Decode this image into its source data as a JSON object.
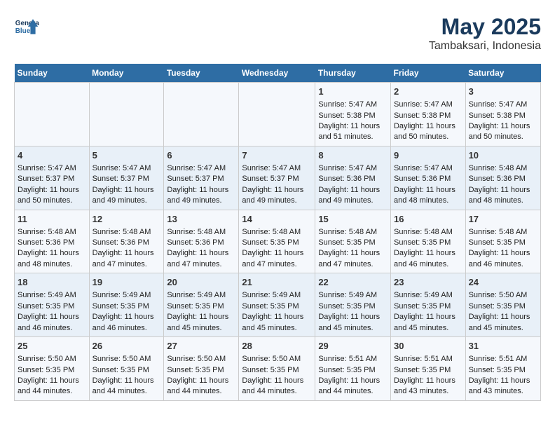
{
  "header": {
    "logo_line1": "General",
    "logo_line2": "Blue",
    "title": "May 2025",
    "subtitle": "Tambaksari, Indonesia"
  },
  "weekdays": [
    "Sunday",
    "Monday",
    "Tuesday",
    "Wednesday",
    "Thursday",
    "Friday",
    "Saturday"
  ],
  "weeks": [
    [
      {
        "day": "",
        "info": ""
      },
      {
        "day": "",
        "info": ""
      },
      {
        "day": "",
        "info": ""
      },
      {
        "day": "",
        "info": ""
      },
      {
        "day": "1",
        "info": "Sunrise: 5:47 AM\nSunset: 5:38 PM\nDaylight: 11 hours\nand 51 minutes."
      },
      {
        "day": "2",
        "info": "Sunrise: 5:47 AM\nSunset: 5:38 PM\nDaylight: 11 hours\nand 50 minutes."
      },
      {
        "day": "3",
        "info": "Sunrise: 5:47 AM\nSunset: 5:38 PM\nDaylight: 11 hours\nand 50 minutes."
      }
    ],
    [
      {
        "day": "4",
        "info": "Sunrise: 5:47 AM\nSunset: 5:37 PM\nDaylight: 11 hours\nand 50 minutes."
      },
      {
        "day": "5",
        "info": "Sunrise: 5:47 AM\nSunset: 5:37 PM\nDaylight: 11 hours\nand 49 minutes."
      },
      {
        "day": "6",
        "info": "Sunrise: 5:47 AM\nSunset: 5:37 PM\nDaylight: 11 hours\nand 49 minutes."
      },
      {
        "day": "7",
        "info": "Sunrise: 5:47 AM\nSunset: 5:37 PM\nDaylight: 11 hours\nand 49 minutes."
      },
      {
        "day": "8",
        "info": "Sunrise: 5:47 AM\nSunset: 5:36 PM\nDaylight: 11 hours\nand 49 minutes."
      },
      {
        "day": "9",
        "info": "Sunrise: 5:47 AM\nSunset: 5:36 PM\nDaylight: 11 hours\nand 48 minutes."
      },
      {
        "day": "10",
        "info": "Sunrise: 5:48 AM\nSunset: 5:36 PM\nDaylight: 11 hours\nand 48 minutes."
      }
    ],
    [
      {
        "day": "11",
        "info": "Sunrise: 5:48 AM\nSunset: 5:36 PM\nDaylight: 11 hours\nand 48 minutes."
      },
      {
        "day": "12",
        "info": "Sunrise: 5:48 AM\nSunset: 5:36 PM\nDaylight: 11 hours\nand 47 minutes."
      },
      {
        "day": "13",
        "info": "Sunrise: 5:48 AM\nSunset: 5:36 PM\nDaylight: 11 hours\nand 47 minutes."
      },
      {
        "day": "14",
        "info": "Sunrise: 5:48 AM\nSunset: 5:35 PM\nDaylight: 11 hours\nand 47 minutes."
      },
      {
        "day": "15",
        "info": "Sunrise: 5:48 AM\nSunset: 5:35 PM\nDaylight: 11 hours\nand 47 minutes."
      },
      {
        "day": "16",
        "info": "Sunrise: 5:48 AM\nSunset: 5:35 PM\nDaylight: 11 hours\nand 46 minutes."
      },
      {
        "day": "17",
        "info": "Sunrise: 5:48 AM\nSunset: 5:35 PM\nDaylight: 11 hours\nand 46 minutes."
      }
    ],
    [
      {
        "day": "18",
        "info": "Sunrise: 5:49 AM\nSunset: 5:35 PM\nDaylight: 11 hours\nand 46 minutes."
      },
      {
        "day": "19",
        "info": "Sunrise: 5:49 AM\nSunset: 5:35 PM\nDaylight: 11 hours\nand 46 minutes."
      },
      {
        "day": "20",
        "info": "Sunrise: 5:49 AM\nSunset: 5:35 PM\nDaylight: 11 hours\nand 45 minutes."
      },
      {
        "day": "21",
        "info": "Sunrise: 5:49 AM\nSunset: 5:35 PM\nDaylight: 11 hours\nand 45 minutes."
      },
      {
        "day": "22",
        "info": "Sunrise: 5:49 AM\nSunset: 5:35 PM\nDaylight: 11 hours\nand 45 minutes."
      },
      {
        "day": "23",
        "info": "Sunrise: 5:49 AM\nSunset: 5:35 PM\nDaylight: 11 hours\nand 45 minutes."
      },
      {
        "day": "24",
        "info": "Sunrise: 5:50 AM\nSunset: 5:35 PM\nDaylight: 11 hours\nand 45 minutes."
      }
    ],
    [
      {
        "day": "25",
        "info": "Sunrise: 5:50 AM\nSunset: 5:35 PM\nDaylight: 11 hours\nand 44 minutes."
      },
      {
        "day": "26",
        "info": "Sunrise: 5:50 AM\nSunset: 5:35 PM\nDaylight: 11 hours\nand 44 minutes."
      },
      {
        "day": "27",
        "info": "Sunrise: 5:50 AM\nSunset: 5:35 PM\nDaylight: 11 hours\nand 44 minutes."
      },
      {
        "day": "28",
        "info": "Sunrise: 5:50 AM\nSunset: 5:35 PM\nDaylight: 11 hours\nand 44 minutes."
      },
      {
        "day": "29",
        "info": "Sunrise: 5:51 AM\nSunset: 5:35 PM\nDaylight: 11 hours\nand 44 minutes."
      },
      {
        "day": "30",
        "info": "Sunrise: 5:51 AM\nSunset: 5:35 PM\nDaylight: 11 hours\nand 43 minutes."
      },
      {
        "day": "31",
        "info": "Sunrise: 5:51 AM\nSunset: 5:35 PM\nDaylight: 11 hours\nand 43 minutes."
      }
    ]
  ]
}
